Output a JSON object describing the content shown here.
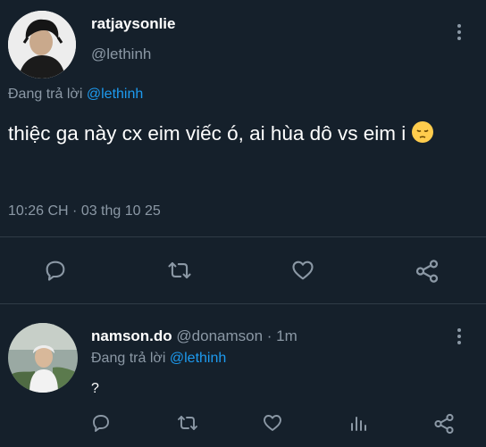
{
  "main_tweet": {
    "display_name": "ratjaysonlie",
    "handle": "@lethinh",
    "replying_prefix": "Đang trả lời",
    "replying_to": "@lethinh",
    "text": "thiệc ga này cx eim viếc ó, ai hùa dô vs eim i",
    "emoji": "pensive-face",
    "timestamp": "10:26 CH · 03 thg 10 25",
    "actions": [
      "reply-icon",
      "retweet-icon",
      "like-icon",
      "share-icon"
    ]
  },
  "reply": {
    "display_name": "namson.do",
    "handle_meta": "@donamson · 1m",
    "replying_prefix": "Đang trả lời",
    "replying_to": "@lethinh",
    "text": "?",
    "actions": [
      "reply-icon",
      "retweet-icon",
      "like-icon",
      "analytics-icon",
      "share-icon"
    ]
  },
  "colors": {
    "background": "#15202b",
    "muted": "#8b98a5",
    "accent": "#1d9bf0",
    "divider": "#2f3b46"
  }
}
